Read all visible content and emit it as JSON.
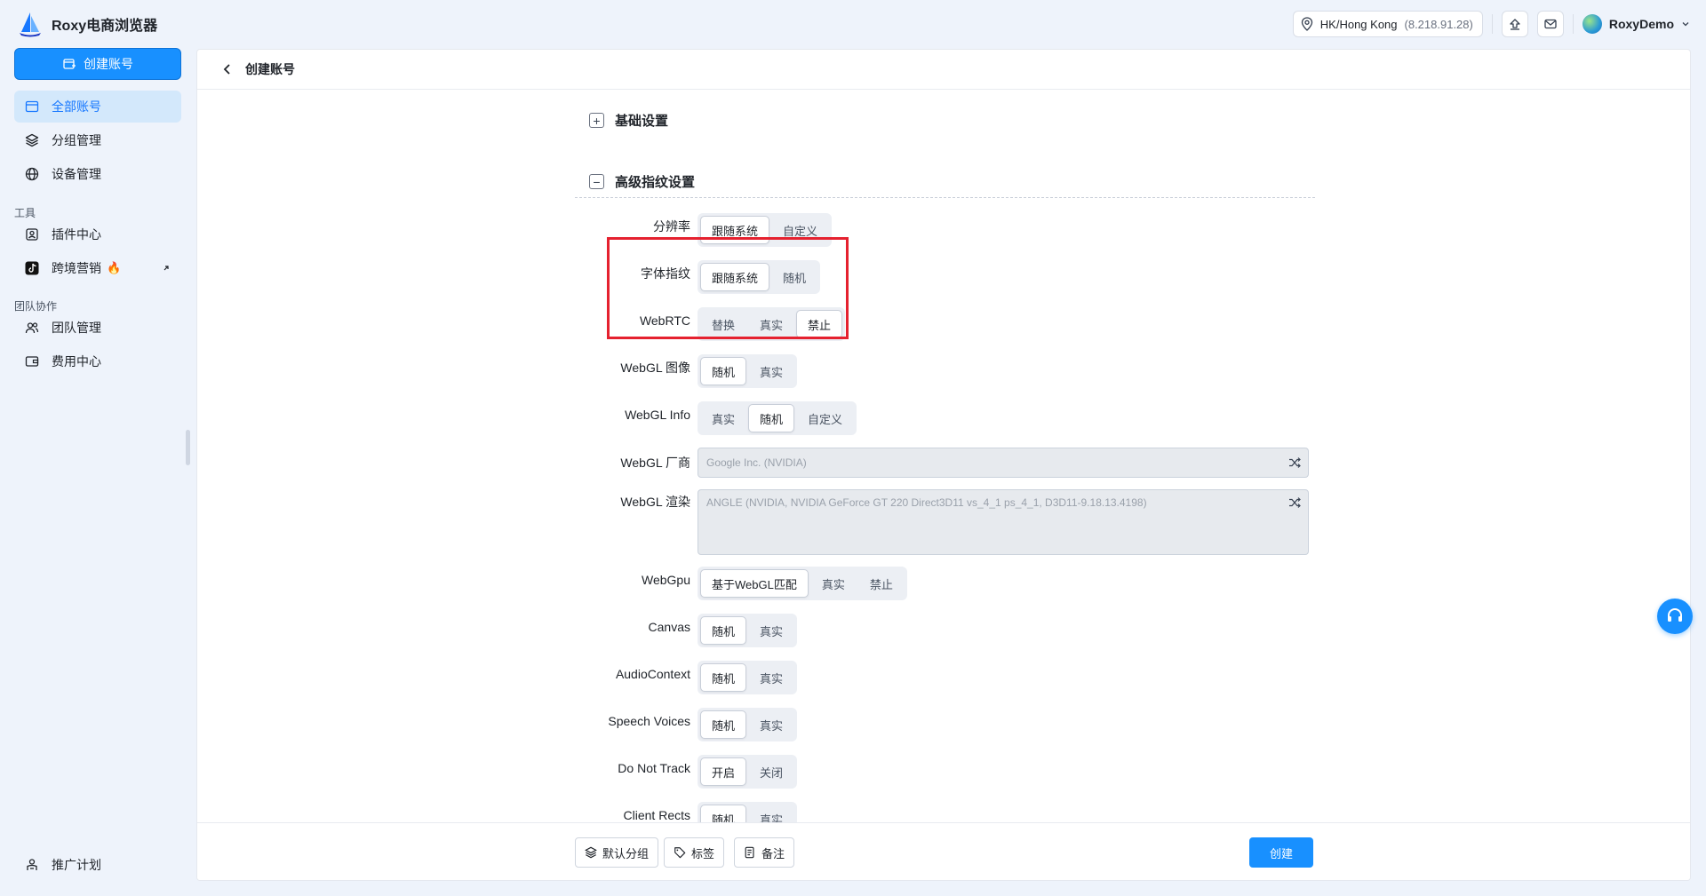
{
  "app": {
    "name": "Roxy电商浏览器"
  },
  "header": {
    "ip_location": "HK/Hong Kong",
    "ip_address": "(8.218.91.28)",
    "user_name": "RoxyDemo"
  },
  "sidebar": {
    "create_label": "创建账号",
    "items": [
      {
        "label": "全部账号",
        "active": true
      },
      {
        "label": "分组管理"
      },
      {
        "label": "设备管理"
      }
    ],
    "tools_section": "工具",
    "tools": [
      {
        "label": "插件中心"
      },
      {
        "label": "跨境营销"
      }
    ],
    "team_section": "团队协作",
    "team": [
      {
        "label": "团队管理"
      },
      {
        "label": "费用中心"
      }
    ],
    "bottom_item": "推广计划"
  },
  "page": {
    "title": "创建账号",
    "basic_section": "基础设置",
    "advanced_section": "高级指纹设置"
  },
  "settings": {
    "resolution": {
      "label": "分辨率",
      "options": [
        "跟随系统",
        "自定义"
      ],
      "selected": 0
    },
    "font": {
      "label": "字体指纹",
      "options": [
        "跟随系统",
        "随机"
      ],
      "selected": 0
    },
    "webrtc": {
      "label": "WebRTC",
      "options": [
        "替换",
        "真实",
        "禁止"
      ],
      "selected": 2
    },
    "webgl_image": {
      "label": "WebGL 图像",
      "options": [
        "随机",
        "真实"
      ],
      "selected": 0
    },
    "webgl_info": {
      "label": "WebGL Info",
      "options": [
        "真实",
        "随机",
        "自定义"
      ],
      "selected": 1
    },
    "webgl_vendor": {
      "label": "WebGL 厂商",
      "value": "Google Inc. (NVIDIA)"
    },
    "webgl_renderer": {
      "label": "WebGL 渲染",
      "value": "ANGLE (NVIDIA, NVIDIA GeForce GT 220  Direct3D11 vs_4_1 ps_4_1, D3D11-9.18.13.4198)"
    },
    "webgpu": {
      "label": "WebGpu",
      "options": [
        "基于WebGL匹配",
        "真实",
        "禁止"
      ],
      "selected": 0
    },
    "canvas": {
      "label": "Canvas",
      "options": [
        "随机",
        "真实"
      ],
      "selected": 0
    },
    "audio": {
      "label": "AudioContext",
      "options": [
        "随机",
        "真实"
      ],
      "selected": 0
    },
    "speech": {
      "label": "Speech Voices",
      "options": [
        "随机",
        "真实"
      ],
      "selected": 0
    },
    "dnt": {
      "label": "Do Not Track",
      "options": [
        "开启",
        "关闭"
      ],
      "selected": 0
    },
    "client_rects": {
      "label": "Client Rects",
      "options": [
        "随机",
        "真实"
      ],
      "selected": 0
    }
  },
  "footer": {
    "group_label": "默认分组",
    "tag_label": "标签",
    "note_label": "备注",
    "submit_label": "创建"
  }
}
